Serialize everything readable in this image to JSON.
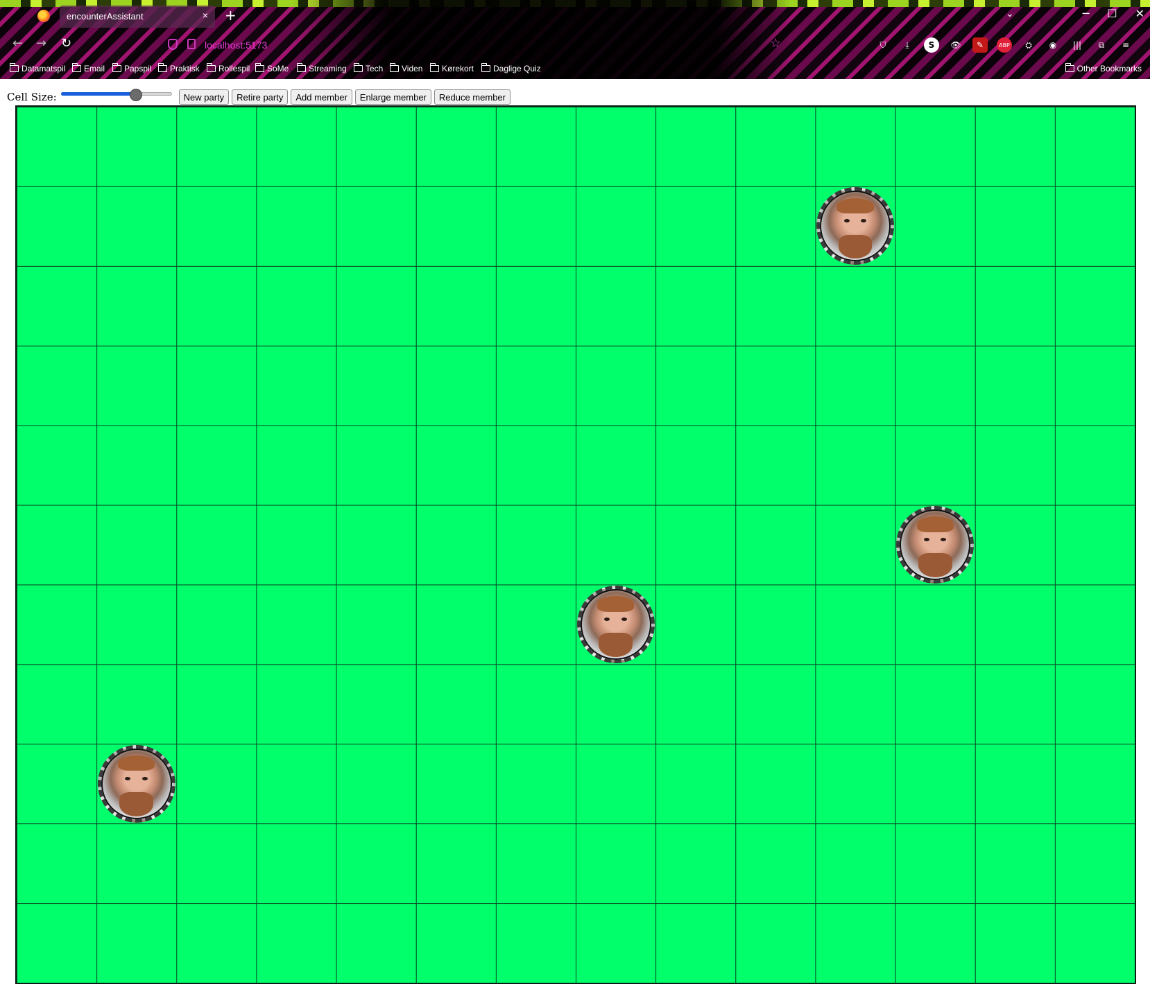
{
  "browser": {
    "tab_title": "encounterAssistant",
    "tab_close": "×",
    "new_tab": "+",
    "url": "localhost:5173",
    "win_min": "─",
    "win_max": "☐",
    "win_close": "✕",
    "tab_list": "⌄",
    "back": "←",
    "forward": "→",
    "reload": "↻",
    "star": "☆",
    "toolbar_icons": [
      "pocket-icon",
      "download-icon",
      "skype-icon",
      "extension-eye-icon",
      "red-extension-icon",
      "adblock-icon",
      "profile-icon",
      "globe-icon",
      "library-icon",
      "extensions-icon",
      "menu-icon"
    ],
    "toolbar_glyphs": [
      "⛉",
      "⤓",
      "S",
      "👁",
      "✎",
      "ABP",
      "⛭",
      "◉",
      "|||",
      "⧉",
      "≡"
    ],
    "bookmarks": [
      "Datamatspil",
      "Email",
      "Papspil",
      "Praktisk",
      "Rollespil",
      "SoMe",
      "Streaming",
      "Tech",
      "Viden",
      "Kørekort",
      "Daglige Quiz"
    ],
    "other_bookmarks": "Other Bookmarks"
  },
  "controls": {
    "cell_size_label": "Cell Size:",
    "cell_size_value": 0.68,
    "buttons": {
      "new_party": "New party",
      "retire_party": "Retire party",
      "add_member": "Add member",
      "enlarge_member": "Enlarge member",
      "reduce_member": "Reduce member"
    }
  },
  "grid": {
    "columns": 14,
    "rows": 11,
    "background": "#00ff6a",
    "line_color": "#0a3f22",
    "tokens": [
      {
        "name": "member-1",
        "col": 10,
        "row": 1
      },
      {
        "name": "member-2",
        "col": 11,
        "row": 5
      },
      {
        "name": "member-3",
        "col": 7,
        "row": 6
      },
      {
        "name": "member-4",
        "col": 1,
        "row": 8
      }
    ]
  },
  "colors": {
    "chrome_accent": "#e23bd2",
    "slider_fill": "#1a5fdb"
  }
}
